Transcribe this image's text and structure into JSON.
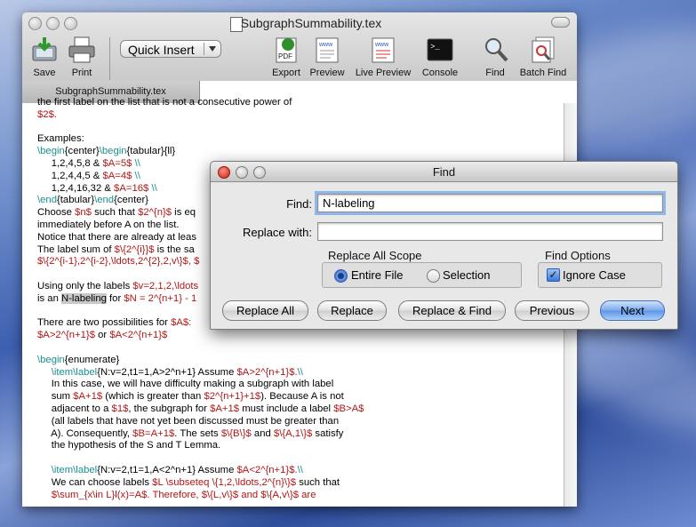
{
  "window": {
    "title": "SubgraphSummability.tex",
    "tab_label": "SubgraphSummability.tex"
  },
  "toolbar": {
    "save": "Save",
    "print": "Print",
    "quick_insert": "Quick Insert",
    "export": "Export",
    "preview": "Preview",
    "live_preview": "Live Preview",
    "console": "Console",
    "find": "Find",
    "batch_find": "Batch Find"
  },
  "editor_lines": [
    [
      {
        "t": "the first label on the list that is not a consecutive power of",
        "c": ""
      }
    ],
    [
      {
        "t": "$2$.",
        "c": "math"
      }
    ],
    [
      {
        "t": "",
        "c": ""
      }
    ],
    [
      {
        "t": "Examples:",
        "c": ""
      }
    ],
    [
      {
        "t": "\\begin",
        "c": "cmd"
      },
      {
        "t": "{center}",
        "c": ""
      },
      {
        "t": "\\begin",
        "c": "cmd"
      },
      {
        "t": "{tabular}{ll}",
        "c": ""
      }
    ],
    [
      {
        "t": "     1,2,4,5,8 & ",
        "c": ""
      },
      {
        "t": "$A=5$",
        "c": "math"
      },
      {
        "t": " \\\\",
        "c": "cmd"
      }
    ],
    [
      {
        "t": "     1,2,4,4,5 & ",
        "c": ""
      },
      {
        "t": "$A=4$",
        "c": "math"
      },
      {
        "t": " \\\\",
        "c": "cmd"
      }
    ],
    [
      {
        "t": "     1,2,4,16,32 & ",
        "c": ""
      },
      {
        "t": "$A=16$",
        "c": "math"
      },
      {
        "t": " \\\\",
        "c": "cmd"
      }
    ],
    [
      {
        "t": "\\end",
        "c": "cmd"
      },
      {
        "t": "{tabular}",
        "c": ""
      },
      {
        "t": "\\end",
        "c": "cmd"
      },
      {
        "t": "{center}",
        "c": ""
      }
    ],
    [
      {
        "t": "Choose ",
        "c": ""
      },
      {
        "t": "$n$",
        "c": "math"
      },
      {
        "t": " such that ",
        "c": ""
      },
      {
        "t": "$2^{n}$",
        "c": "math"
      },
      {
        "t": " is eq",
        "c": ""
      }
    ],
    [
      {
        "t": "immediately before A on the list.",
        "c": ""
      }
    ],
    [
      {
        "t": "Notice that there are already at leas",
        "c": ""
      }
    ],
    [
      {
        "t": "The label sum of ",
        "c": ""
      },
      {
        "t": "$\\{2^{i}}$",
        "c": "math"
      },
      {
        "t": " is the sa",
        "c": ""
      }
    ],
    [
      {
        "t": "$\\{2^{i-1},2^{i-2},\\ldots,2^{2},2,v\\}$, $",
        "c": "math"
      }
    ],
    [
      {
        "t": "",
        "c": ""
      }
    ],
    [
      {
        "t": "Using only the labels ",
        "c": ""
      },
      {
        "t": "$v=2,1,2,\\ldots",
        "c": "math"
      }
    ],
    [
      {
        "t": "is an ",
        "c": ""
      },
      {
        "t": "N-labeling",
        "c": "hl"
      },
      {
        "t": " for ",
        "c": ""
      },
      {
        "t": "$N = 2^{n+1} - 1",
        "c": "math"
      }
    ],
    [
      {
        "t": "",
        "c": ""
      }
    ],
    [
      {
        "t": "There are two possibilities for ",
        "c": ""
      },
      {
        "t": "$A$:",
        "c": "math"
      }
    ],
    [
      {
        "t": "$A>2^{n+1}$",
        "c": "math"
      },
      {
        "t": " or ",
        "c": ""
      },
      {
        "t": "$A<2^{n+1}$",
        "c": "math"
      }
    ],
    [
      {
        "t": "",
        "c": ""
      }
    ],
    [
      {
        "t": "\\begin",
        "c": "cmd"
      },
      {
        "t": "{enumerate}",
        "c": ""
      }
    ],
    [
      {
        "t": "     \\item\\label",
        "c": "cmd"
      },
      {
        "t": "{N:v=2,t1=1,A>2^n+1}",
        "c": ""
      },
      {
        "t": " Assume ",
        "c": ""
      },
      {
        "t": "$A>2^{n+1}$.",
        "c": "math"
      },
      {
        "t": "\\\\",
        "c": "cmd"
      }
    ],
    [
      {
        "t": "     In this case, we will have difficulty making a subgraph with label",
        "c": ""
      }
    ],
    [
      {
        "t": "     sum ",
        "c": ""
      },
      {
        "t": "$A+1$",
        "c": "math"
      },
      {
        "t": " (which is greater than ",
        "c": ""
      },
      {
        "t": "$2^{n+1}+1$",
        "c": "math"
      },
      {
        "t": "). Because A is not",
        "c": ""
      }
    ],
    [
      {
        "t": "     adjacent to a ",
        "c": ""
      },
      {
        "t": "$1$",
        "c": "math"
      },
      {
        "t": ", the subgraph for ",
        "c": ""
      },
      {
        "t": "$A+1$",
        "c": "math"
      },
      {
        "t": " must include a label ",
        "c": ""
      },
      {
        "t": "$B>A$",
        "c": "math"
      }
    ],
    [
      {
        "t": "     (all labels that have not yet been discussed must be greater than",
        "c": ""
      }
    ],
    [
      {
        "t": "     A). Consequently, ",
        "c": ""
      },
      {
        "t": "$B=A+1$",
        "c": "math"
      },
      {
        "t": ". The sets ",
        "c": ""
      },
      {
        "t": "$\\{B\\}$",
        "c": "math"
      },
      {
        "t": " and ",
        "c": ""
      },
      {
        "t": "$\\{A,1\\}$",
        "c": "math"
      },
      {
        "t": " satisfy",
        "c": ""
      }
    ],
    [
      {
        "t": "     the hypothesis of the S and T Lemma.",
        "c": ""
      }
    ],
    [
      {
        "t": "",
        "c": ""
      }
    ],
    [
      {
        "t": "     \\item\\label",
        "c": "cmd"
      },
      {
        "t": "{N:v=2,t1=1,A<2^n+1}",
        "c": ""
      },
      {
        "t": " Assume ",
        "c": ""
      },
      {
        "t": "$A<2^{n+1}$.",
        "c": "math"
      },
      {
        "t": "\\\\",
        "c": "cmd"
      }
    ],
    [
      {
        "t": "     We can choose labels ",
        "c": ""
      },
      {
        "t": "$L \\subseteq \\{1,2,\\ldots,2^{n}\\}$",
        "c": "math"
      },
      {
        "t": " such that",
        "c": ""
      }
    ],
    [
      {
        "t": "     $\\sum_{x\\in L}l(x)=A$. Therefore, $\\{L,v\\}$ and $\\{A,v\\}$ are",
        "c": "math"
      }
    ]
  ],
  "find_dialog": {
    "title": "Find",
    "find_label": "Find:",
    "find_value": "N-labeling",
    "replace_label": "Replace with:",
    "replace_value": "",
    "scope_title": "Replace All Scope",
    "scope_entire": "Entire File",
    "scope_selection": "Selection",
    "options_title": "Find Options",
    "ignore_case": "Ignore Case",
    "btn_replace_all": "Replace All",
    "btn_replace": "Replace",
    "btn_replace_find": "Replace & Find",
    "btn_previous": "Previous",
    "btn_next": "Next"
  }
}
